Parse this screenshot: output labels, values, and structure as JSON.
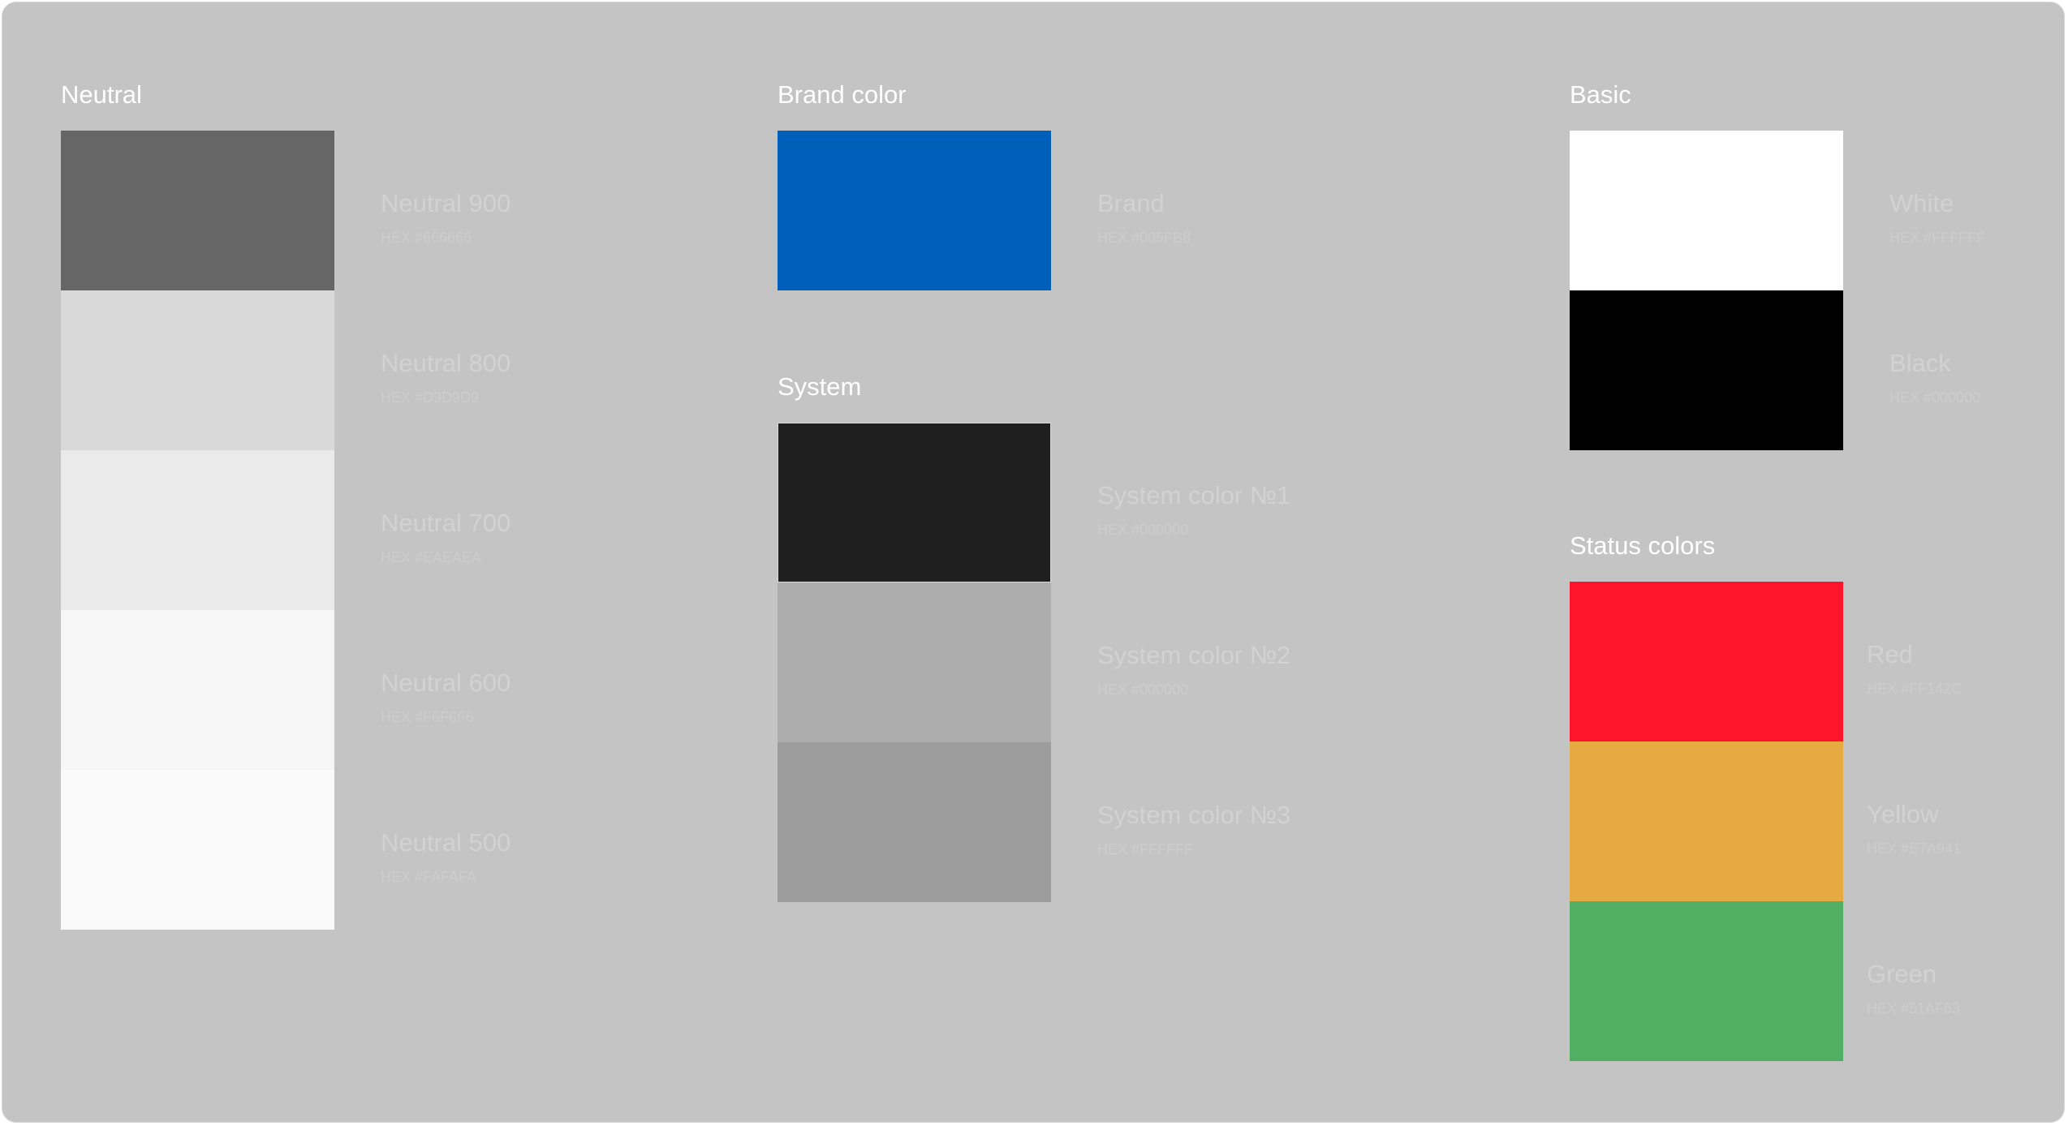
{
  "neutral": {
    "title": "Neutral",
    "swatches": [
      {
        "label": "Neutral 900",
        "hex": "HEX #666666",
        "color": "#666666"
      },
      {
        "label": "Neutral 800",
        "hex": "HEX #D9D9D9",
        "color": "#D9D9D9"
      },
      {
        "label": "Neutral 700",
        "hex": "HEX #EAEAEA",
        "color": "#EAEAEA"
      },
      {
        "label": "Neutral 600",
        "hex": "HEX #F6F6F6",
        "color": "#F6F6F6"
      },
      {
        "label": "Neutral 500",
        "hex": "HEX #FAFAFA",
        "color": "#FAFAFA"
      }
    ]
  },
  "brand": {
    "title": "Brand color",
    "swatches": [
      {
        "label": "Brand",
        "hex": "HEX #005FB8",
        "color": "#005FB8"
      }
    ]
  },
  "system": {
    "title": "System",
    "swatches": [
      {
        "label": "System color №1",
        "hex": "HEX #000000",
        "color": "#1F1F1F"
      },
      {
        "label": "System color №2",
        "hex": "HEX #000000",
        "color": "#ADADAD"
      },
      {
        "label": "System color №3",
        "hex": "HEX #FFFFFF",
        "color": "#9C9C9C"
      }
    ]
  },
  "basic": {
    "title": "Basic",
    "swatches": [
      {
        "label": "White",
        "hex": "HEX #FFFFFF",
        "color": "#FFFFFF"
      },
      {
        "label": "Black",
        "hex": "HEX #000000",
        "color": "#000000"
      }
    ]
  },
  "status": {
    "title": "Status colors",
    "swatches": [
      {
        "label": "Red",
        "hex": "HEX #FF142C",
        "color": "#FF142C"
      },
      {
        "label": "Yellow",
        "hex": "HEX #E7A941",
        "color": "#E7A941"
      },
      {
        "label": "Green",
        "hex": "HEX #51AF63",
        "color": "#51AF63"
      }
    ]
  }
}
